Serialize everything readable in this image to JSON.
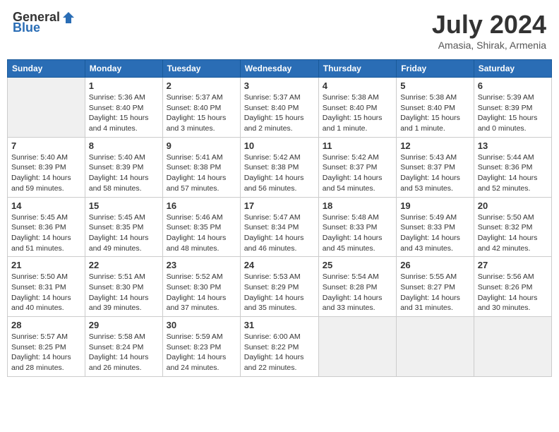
{
  "header": {
    "logo_general": "General",
    "logo_blue": "Blue",
    "month_title": "July 2024",
    "location": "Amasia, Shirak, Armenia"
  },
  "days_of_week": [
    "Sunday",
    "Monday",
    "Tuesday",
    "Wednesday",
    "Thursday",
    "Friday",
    "Saturday"
  ],
  "weeks": [
    [
      {
        "day": "",
        "info": ""
      },
      {
        "day": "1",
        "info": "Sunrise: 5:36 AM\nSunset: 8:40 PM\nDaylight: 15 hours\nand 4 minutes."
      },
      {
        "day": "2",
        "info": "Sunrise: 5:37 AM\nSunset: 8:40 PM\nDaylight: 15 hours\nand 3 minutes."
      },
      {
        "day": "3",
        "info": "Sunrise: 5:37 AM\nSunset: 8:40 PM\nDaylight: 15 hours\nand 2 minutes."
      },
      {
        "day": "4",
        "info": "Sunrise: 5:38 AM\nSunset: 8:40 PM\nDaylight: 15 hours\nand 1 minute."
      },
      {
        "day": "5",
        "info": "Sunrise: 5:38 AM\nSunset: 8:40 PM\nDaylight: 15 hours\nand 1 minute."
      },
      {
        "day": "6",
        "info": "Sunrise: 5:39 AM\nSunset: 8:39 PM\nDaylight: 15 hours\nand 0 minutes."
      }
    ],
    [
      {
        "day": "7",
        "info": "Sunrise: 5:40 AM\nSunset: 8:39 PM\nDaylight: 14 hours\nand 59 minutes."
      },
      {
        "day": "8",
        "info": "Sunrise: 5:40 AM\nSunset: 8:39 PM\nDaylight: 14 hours\nand 58 minutes."
      },
      {
        "day": "9",
        "info": "Sunrise: 5:41 AM\nSunset: 8:38 PM\nDaylight: 14 hours\nand 57 minutes."
      },
      {
        "day": "10",
        "info": "Sunrise: 5:42 AM\nSunset: 8:38 PM\nDaylight: 14 hours\nand 56 minutes."
      },
      {
        "day": "11",
        "info": "Sunrise: 5:42 AM\nSunset: 8:37 PM\nDaylight: 14 hours\nand 54 minutes."
      },
      {
        "day": "12",
        "info": "Sunrise: 5:43 AM\nSunset: 8:37 PM\nDaylight: 14 hours\nand 53 minutes."
      },
      {
        "day": "13",
        "info": "Sunrise: 5:44 AM\nSunset: 8:36 PM\nDaylight: 14 hours\nand 52 minutes."
      }
    ],
    [
      {
        "day": "14",
        "info": "Sunrise: 5:45 AM\nSunset: 8:36 PM\nDaylight: 14 hours\nand 51 minutes."
      },
      {
        "day": "15",
        "info": "Sunrise: 5:45 AM\nSunset: 8:35 PM\nDaylight: 14 hours\nand 49 minutes."
      },
      {
        "day": "16",
        "info": "Sunrise: 5:46 AM\nSunset: 8:35 PM\nDaylight: 14 hours\nand 48 minutes."
      },
      {
        "day": "17",
        "info": "Sunrise: 5:47 AM\nSunset: 8:34 PM\nDaylight: 14 hours\nand 46 minutes."
      },
      {
        "day": "18",
        "info": "Sunrise: 5:48 AM\nSunset: 8:33 PM\nDaylight: 14 hours\nand 45 minutes."
      },
      {
        "day": "19",
        "info": "Sunrise: 5:49 AM\nSunset: 8:33 PM\nDaylight: 14 hours\nand 43 minutes."
      },
      {
        "day": "20",
        "info": "Sunrise: 5:50 AM\nSunset: 8:32 PM\nDaylight: 14 hours\nand 42 minutes."
      }
    ],
    [
      {
        "day": "21",
        "info": "Sunrise: 5:50 AM\nSunset: 8:31 PM\nDaylight: 14 hours\nand 40 minutes."
      },
      {
        "day": "22",
        "info": "Sunrise: 5:51 AM\nSunset: 8:30 PM\nDaylight: 14 hours\nand 39 minutes."
      },
      {
        "day": "23",
        "info": "Sunrise: 5:52 AM\nSunset: 8:30 PM\nDaylight: 14 hours\nand 37 minutes."
      },
      {
        "day": "24",
        "info": "Sunrise: 5:53 AM\nSunset: 8:29 PM\nDaylight: 14 hours\nand 35 minutes."
      },
      {
        "day": "25",
        "info": "Sunrise: 5:54 AM\nSunset: 8:28 PM\nDaylight: 14 hours\nand 33 minutes."
      },
      {
        "day": "26",
        "info": "Sunrise: 5:55 AM\nSunset: 8:27 PM\nDaylight: 14 hours\nand 31 minutes."
      },
      {
        "day": "27",
        "info": "Sunrise: 5:56 AM\nSunset: 8:26 PM\nDaylight: 14 hours\nand 30 minutes."
      }
    ],
    [
      {
        "day": "28",
        "info": "Sunrise: 5:57 AM\nSunset: 8:25 PM\nDaylight: 14 hours\nand 28 minutes."
      },
      {
        "day": "29",
        "info": "Sunrise: 5:58 AM\nSunset: 8:24 PM\nDaylight: 14 hours\nand 26 minutes."
      },
      {
        "day": "30",
        "info": "Sunrise: 5:59 AM\nSunset: 8:23 PM\nDaylight: 14 hours\nand 24 minutes."
      },
      {
        "day": "31",
        "info": "Sunrise: 6:00 AM\nSunset: 8:22 PM\nDaylight: 14 hours\nand 22 minutes."
      },
      {
        "day": "",
        "info": ""
      },
      {
        "day": "",
        "info": ""
      },
      {
        "day": "",
        "info": ""
      }
    ]
  ]
}
